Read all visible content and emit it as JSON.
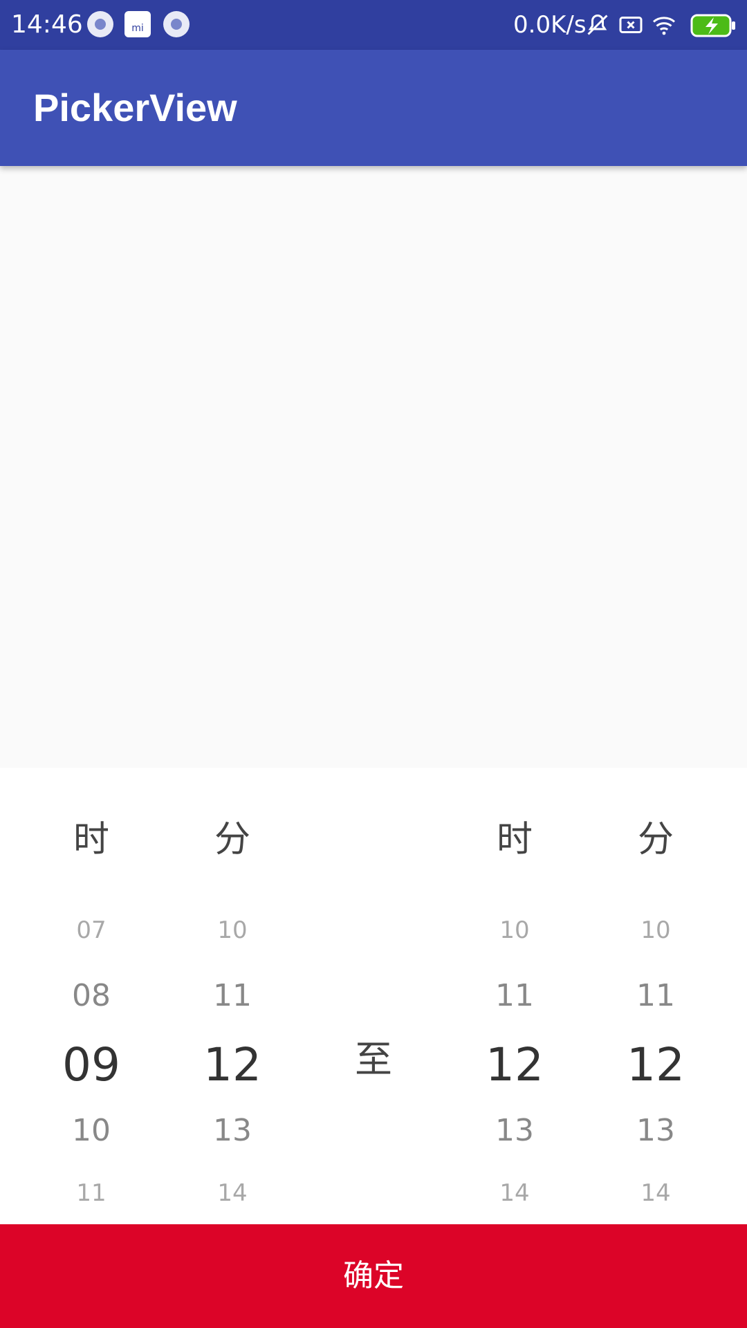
{
  "status_bar": {
    "time": "14:46",
    "net_speed": "0.0K/s"
  },
  "app_bar": {
    "title": "PickerView"
  },
  "picker": {
    "col1": {
      "unit": "时",
      "items": [
        "07",
        "08",
        "09",
        "10",
        "11"
      ],
      "selected": "09"
    },
    "col2": {
      "unit": "分",
      "items": [
        "10",
        "11",
        "12",
        "13",
        "14"
      ],
      "selected": "12"
    },
    "separator": "至",
    "col3": {
      "unit": "时",
      "items": [
        "10",
        "11",
        "12",
        "13",
        "14"
      ],
      "selected": "12"
    },
    "col4": {
      "unit": "分",
      "items": [
        "10",
        "11",
        "12",
        "13",
        "14"
      ],
      "selected": "12"
    }
  },
  "confirm_label": "确定"
}
